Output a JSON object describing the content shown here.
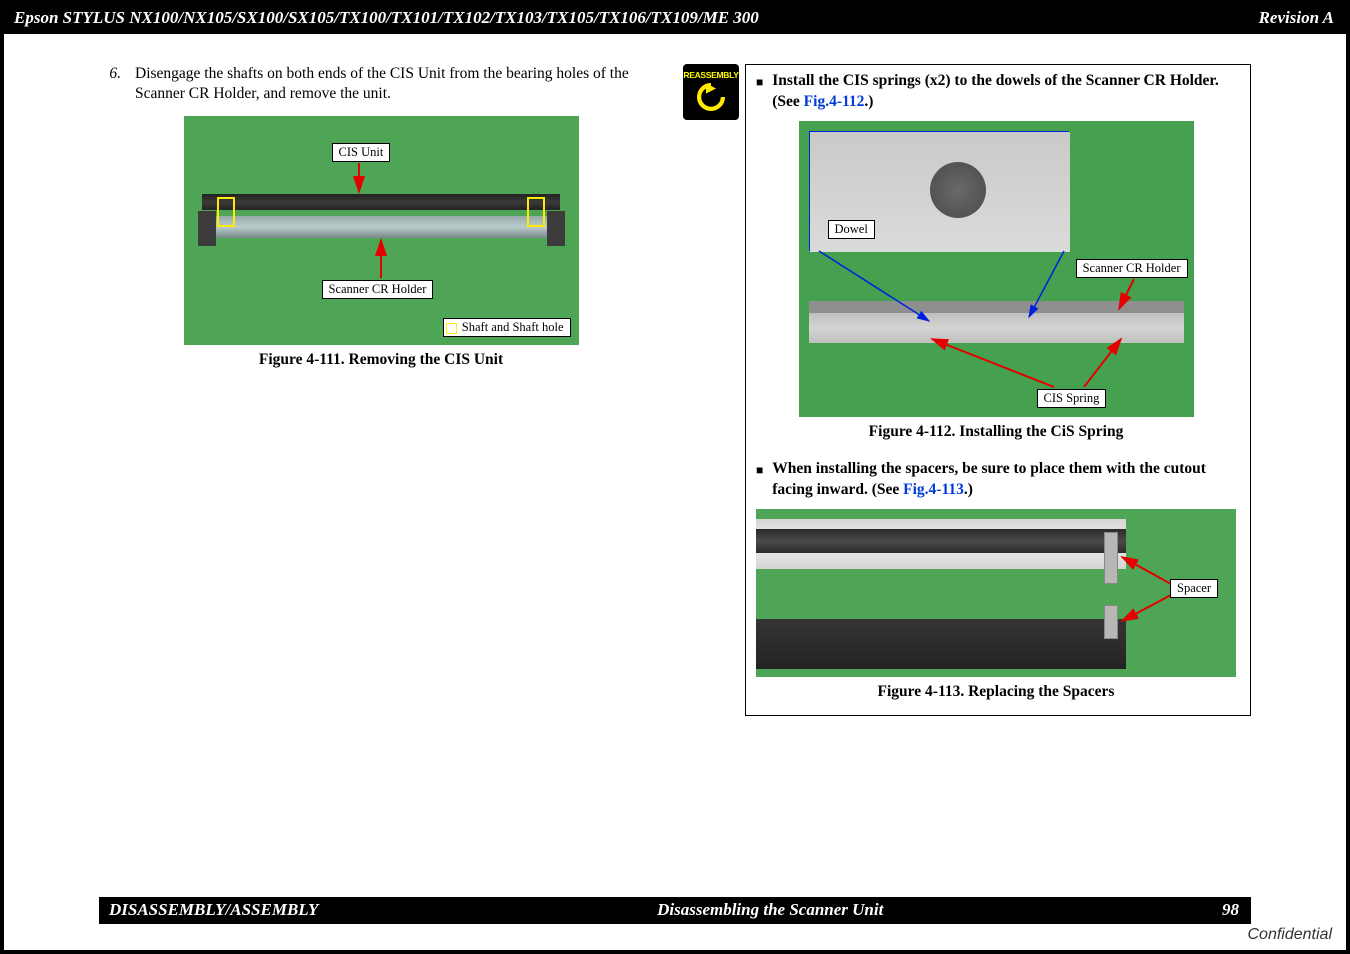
{
  "header": {
    "title": "Epson STYLUS NX100/NX105/SX100/SX105/TX100/TX101/TX102/TX103/TX105/TX106/TX109/ME 300",
    "revision": "Revision A"
  },
  "footer": {
    "section": "DISASSEMBLY/ASSEMBLY",
    "subsection": "Disassembling the Scanner Unit",
    "page": "98",
    "confidential": "Confidential"
  },
  "left": {
    "step_num": "6.",
    "step_text": "Disengage the shafts on both ends of the CIS Unit from the bearing holes of the Scanner CR Holder, and remove the unit.",
    "labels": {
      "cis_unit": "CIS Unit",
      "scanner_cr_holder": "Scanner CR Holder",
      "shaft": "Shaft and Shaft hole"
    },
    "caption": "Figure 4-111.  Removing the CIS Unit"
  },
  "right": {
    "reassembly": "REASSEMBLY",
    "bullet1_pre": "Install the CIS springs (x2) to the dowels of the Scanner CR Holder. (See ",
    "bullet1_link": "Fig.4-112",
    "bullet1_post": ".)",
    "labels1": {
      "dowel": "Dowel",
      "scanner_cr_holder": "Scanner CR Holder",
      "cis_spring": "CIS Spring"
    },
    "caption1": "Figure 4-112.  Installing the CiS Spring",
    "bullet2_pre": "When installing the spacers, be sure to place them with the cutout facing inward. (See ",
    "bullet2_link": "Fig.4-113",
    "bullet2_post": ".)",
    "labels2": {
      "spacer": "Spacer"
    },
    "caption2": "Figure 4-113.  Replacing the Spacers"
  }
}
